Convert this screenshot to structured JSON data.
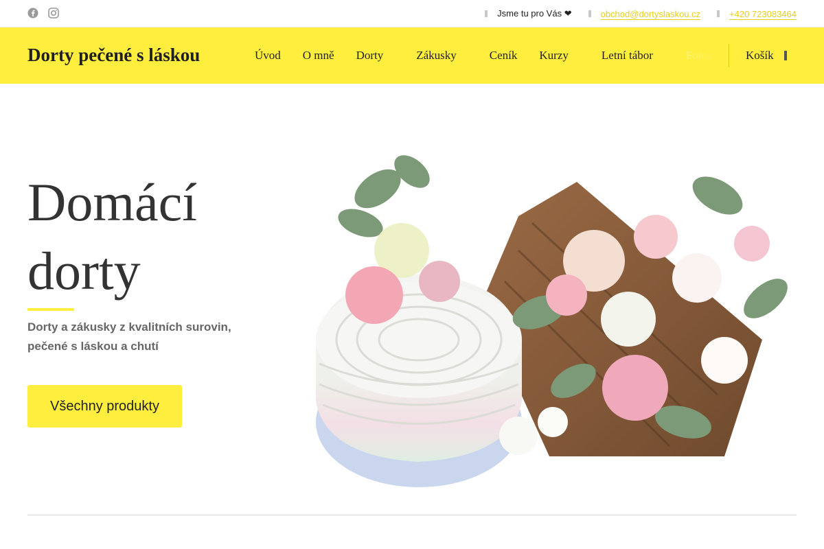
{
  "topbar": {
    "social": [
      {
        "name": "facebook-icon"
      },
      {
        "name": "instagram-icon"
      }
    ],
    "tagline": "Jsme tu pro Vás ❤",
    "email": "obchod@dortyslaskou.cz",
    "phone": "+420 723083464"
  },
  "brand": {
    "title": "Dorty pečené s láskou"
  },
  "nav": {
    "items": [
      {
        "label": "Úvod",
        "dropdown": false
      },
      {
        "label": "O mně",
        "dropdown": false
      },
      {
        "label": "Dorty",
        "dropdown": true
      },
      {
        "label": "Zákusky",
        "dropdown": true
      },
      {
        "label": "Ceník",
        "dropdown": false
      },
      {
        "label": "Kurzy",
        "dropdown": true
      },
      {
        "label": "Letní tábor",
        "dropdown": true
      },
      {
        "label": "Fotogalerie",
        "dropdown": false
      }
    ],
    "cart_label": "Košík"
  },
  "hero": {
    "title_line1": "Domácí",
    "title_line2": "dorty",
    "subtitle": "Dorty a zákusky z kvalitních surovin, pečené s láskou a chutí",
    "cta_label": "Všechny produkty"
  },
  "colors": {
    "accent": "#ffee3d",
    "link": "#e6cf1a",
    "text": "#333333"
  }
}
